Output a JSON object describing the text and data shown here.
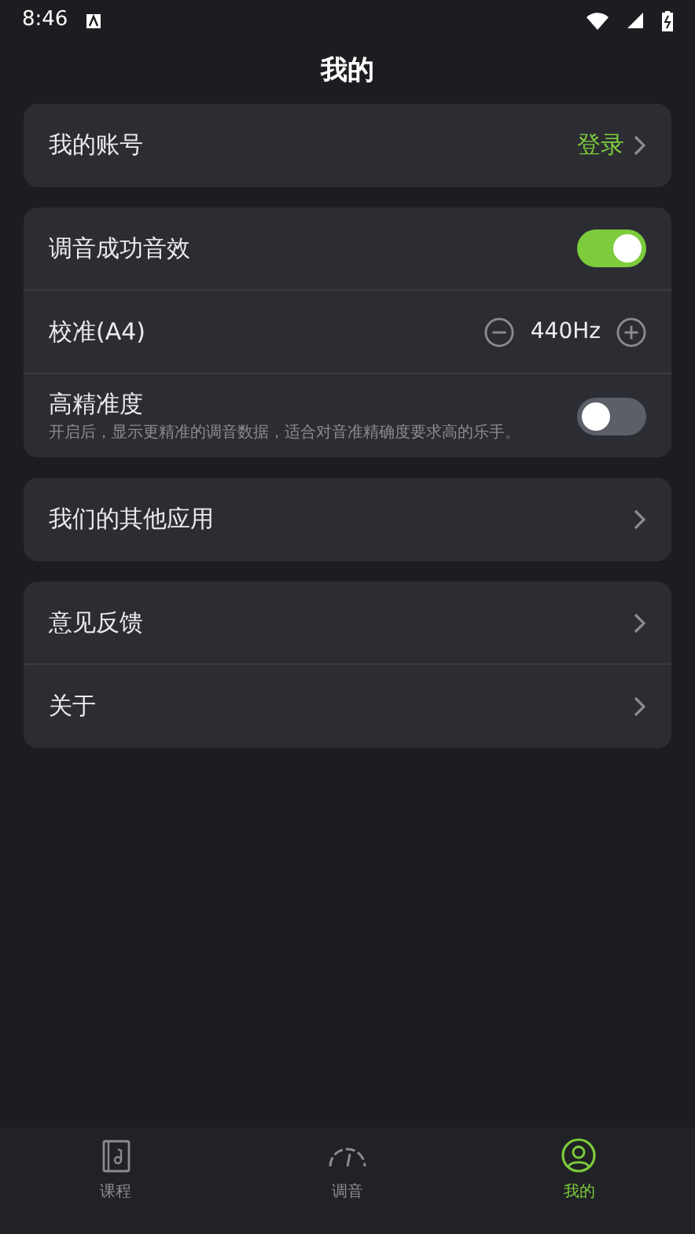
{
  "status_bar": {
    "time": "8:46"
  },
  "title": "我的",
  "groups": [
    {
      "rows": [
        {
          "kind": "link",
          "label": "我的账号",
          "value": "登录"
        }
      ]
    },
    {
      "rows": [
        {
          "kind": "toggle",
          "label": "调音成功音效",
          "on": true
        },
        {
          "kind": "stepper",
          "label": "校准(A4)",
          "value": "440Hz"
        },
        {
          "kind": "toggle",
          "label": "高精准度",
          "description": "开启后，显示更精准的调音数据，适合对音准精确度要求高的乐手。",
          "on": false
        }
      ]
    },
    {
      "rows": [
        {
          "kind": "link",
          "label": "我们的其他应用"
        }
      ]
    },
    {
      "rows": [
        {
          "kind": "link",
          "label": "意见反馈"
        },
        {
          "kind": "link",
          "label": "关于"
        }
      ]
    }
  ],
  "tabs": [
    {
      "label": "课程",
      "kind": "book",
      "selected": false
    },
    {
      "label": "调音",
      "kind": "gauge",
      "selected": false
    },
    {
      "label": "我的",
      "kind": "user",
      "selected": true
    }
  ]
}
